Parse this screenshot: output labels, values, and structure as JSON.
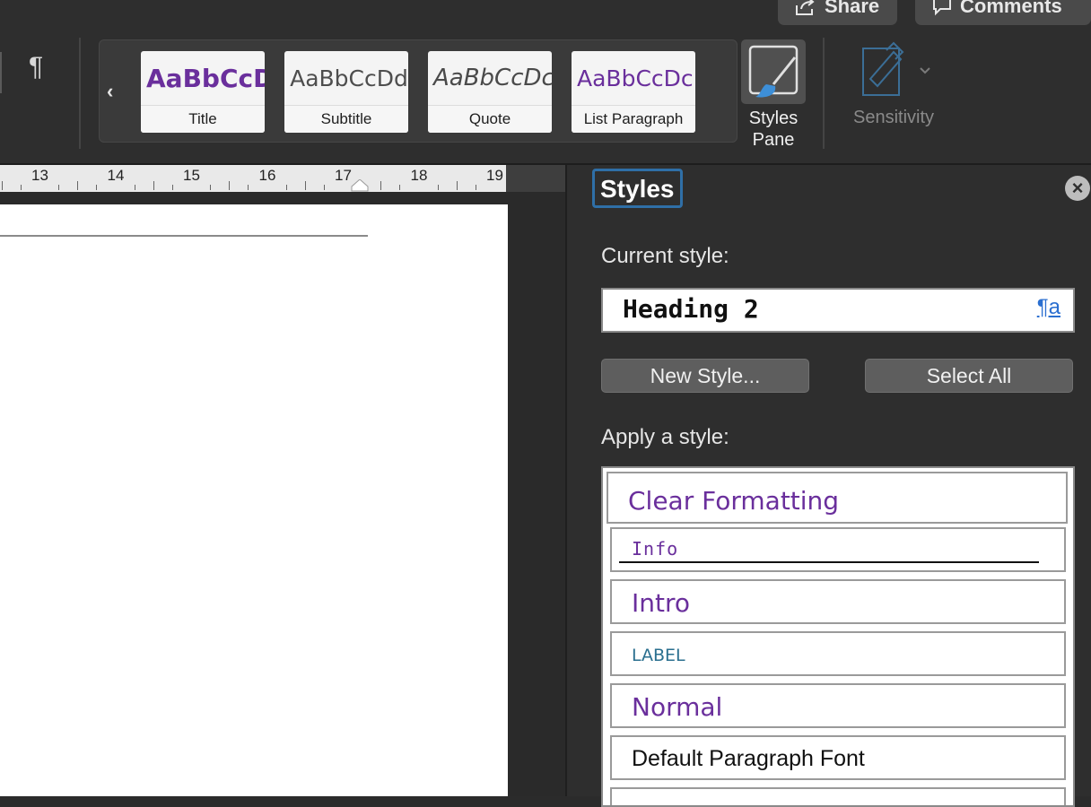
{
  "toolbar": {
    "share_label": "Share",
    "comments_label": "Comments",
    "paragraph_mark": "¶",
    "gallery_prev": "‹",
    "styles_gallery": [
      {
        "preview": "AaBbCcD",
        "name": "Title"
      },
      {
        "preview": "AaBbCcDd",
        "name": "Subtitle"
      },
      {
        "preview": "AaBbCcDc",
        "name": "Quote"
      },
      {
        "preview": "AaBbCcDc",
        "name": "List Paragraph"
      }
    ],
    "styles_pane_label": "Styles Pane",
    "sensitivity_label": "Sensitivity"
  },
  "ruler": {
    "numbers": [
      "13",
      "14",
      "15",
      "16",
      "17",
      "18",
      "19"
    ]
  },
  "styles_pane": {
    "title": "Styles",
    "close_glyph": "×",
    "current_style_label": "Current style:",
    "current_style_value": "Heading 2",
    "current_style_icon": "¶a",
    "new_style_label": "New Style...",
    "select_all_label": "Select All",
    "apply_label": "Apply a style:",
    "styles": [
      {
        "name": "Clear Formatting"
      },
      {
        "name": "Info"
      },
      {
        "name": "Intro"
      },
      {
        "name": "LABEL"
      },
      {
        "name": "Normal"
      },
      {
        "name": "Default Paragraph Font"
      }
    ]
  },
  "colors": {
    "accent_purple": "#6a2f9c",
    "focus_blue": "#2f6fa7",
    "label_teal": "#2a6f8f"
  }
}
